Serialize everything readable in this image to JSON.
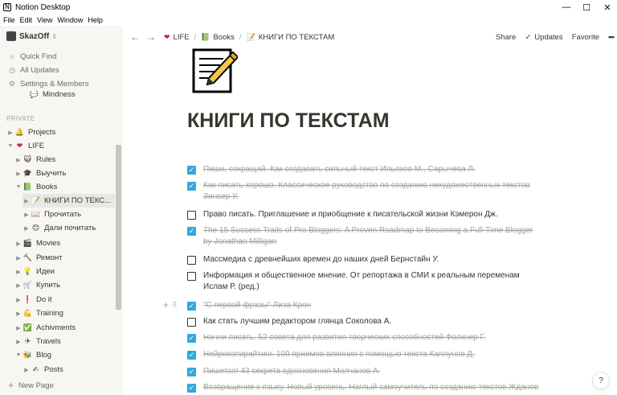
{
  "window": {
    "title": "Notion Desktop",
    "minimize": "—",
    "maximize": "☐",
    "close": "✕"
  },
  "menu": [
    "File",
    "Edit",
    "View",
    "Window",
    "Help"
  ],
  "sidebar": {
    "workspace": "SkazOff",
    "actions": [
      {
        "label": "Quick Find",
        "icon": "search-icon"
      },
      {
        "label": "All Updates",
        "icon": "clock-icon"
      },
      {
        "label": "Settings & Members",
        "icon": "gear-icon"
      }
    ],
    "partial_item": "Mindness",
    "section": "PRIVATE",
    "tree": [
      {
        "label": "Projects",
        "emoji": "🔔",
        "depth": 0,
        "expanded": false
      },
      {
        "label": "LIFE",
        "emoji": "❤",
        "depth": 0,
        "expanded": true
      },
      {
        "label": "Rules",
        "emoji": "😺",
        "depth": 1,
        "expanded": false
      },
      {
        "label": "Выучить",
        "emoji": "🎓",
        "depth": 1,
        "expanded": false
      },
      {
        "label": "Books",
        "emoji": "📗",
        "depth": 1,
        "expanded": true
      },
      {
        "label": "КНИГИ ПО ТЕКС...",
        "emoji": "📝",
        "depth": 2,
        "expanded": false,
        "active": true
      },
      {
        "label": "Прочитать",
        "emoji": "📖",
        "depth": 2,
        "expanded": false
      },
      {
        "label": "Дали почитать",
        "emoji": "😊",
        "depth": 2,
        "expanded": false
      },
      {
        "label": "Movies",
        "emoji": "🎬",
        "depth": 1,
        "expanded": false
      },
      {
        "label": "Ремонт",
        "emoji": "🔨",
        "depth": 1,
        "expanded": false
      },
      {
        "label": "Идеи",
        "emoji": "💡",
        "depth": 1,
        "expanded": false
      },
      {
        "label": "Купить",
        "emoji": "🛒",
        "depth": 1,
        "expanded": false
      },
      {
        "label": "Do it",
        "emoji": "❗",
        "depth": 1,
        "expanded": false
      },
      {
        "label": "Training",
        "emoji": "💪",
        "depth": 1,
        "expanded": false
      },
      {
        "label": "Achivments",
        "emoji": "✅",
        "depth": 1,
        "expanded": false
      },
      {
        "label": "Travels",
        "emoji": "✈",
        "depth": 1,
        "expanded": false
      },
      {
        "label": "Blog",
        "emoji": "🐝",
        "depth": 1,
        "expanded": true
      },
      {
        "label": "Posts",
        "emoji": "✍",
        "depth": 2,
        "expanded": false
      }
    ],
    "new_page": "New Page"
  },
  "topbar": {
    "breadcrumbs": [
      {
        "label": "LIFE",
        "emoji": "❤"
      },
      {
        "label": "Books",
        "emoji": "📗"
      },
      {
        "label": "КНИГИ ПО ТЕКСТАМ",
        "emoji": "📝"
      }
    ],
    "share": "Share",
    "updates": "Updates",
    "favorite": "Favorite",
    "more": "•••"
  },
  "page": {
    "icon": "memo-icon",
    "title": "КНИГИ ПО ТЕКСТАМ",
    "todos": [
      {
        "text": "Пиши, сокращай. Как создавать сильный текст Ильяхов М., Сарычева Л.",
        "done": true
      },
      {
        "text": "Как писать хорошо. Классическое руководство по созданию нехудожественных текстов Зинсер У.",
        "done": true
      },
      {
        "text": "Право писать. Приглашение и приобщение к писательской жизни Кэмерон Дж.",
        "done": false
      },
      {
        "text": "The 15 Success Traits of Pro Bloggers: A Proven Roadmap to Becoming a Full-Time Blogger by Jonathan Milligan",
        "done": true
      },
      {
        "text": "Массмедиа с древнейших времен до наших дней Бернстайн У.",
        "done": false
      },
      {
        "text": "Информация и общественное мнение. От репортажа в СМИ к реальным переменам Ислам Р. (ред.)",
        "done": false
      },
      {
        "text": "\"С первой фразы\" Лиза Крон",
        "done": true
      },
      {
        "text": "Как стать лучшим редактором глянца Соколова А.",
        "done": false
      },
      {
        "text": "Начни писать. 52 совета для развития творческих способностей Фолкнер Г.",
        "done": true
      },
      {
        "text": "Нейрокопирайтинг. 100 приемов влияния с помощью текста Каплунов Д.",
        "done": true
      },
      {
        "text": "Пишется! 43 секрета вдохновения Молчанов А.",
        "done": true
      },
      {
        "text": "Возвращение к языку. Новый уровень. Наглый самоучитель по созданию текстов Жданов",
        "done": true
      }
    ]
  },
  "help": "?"
}
